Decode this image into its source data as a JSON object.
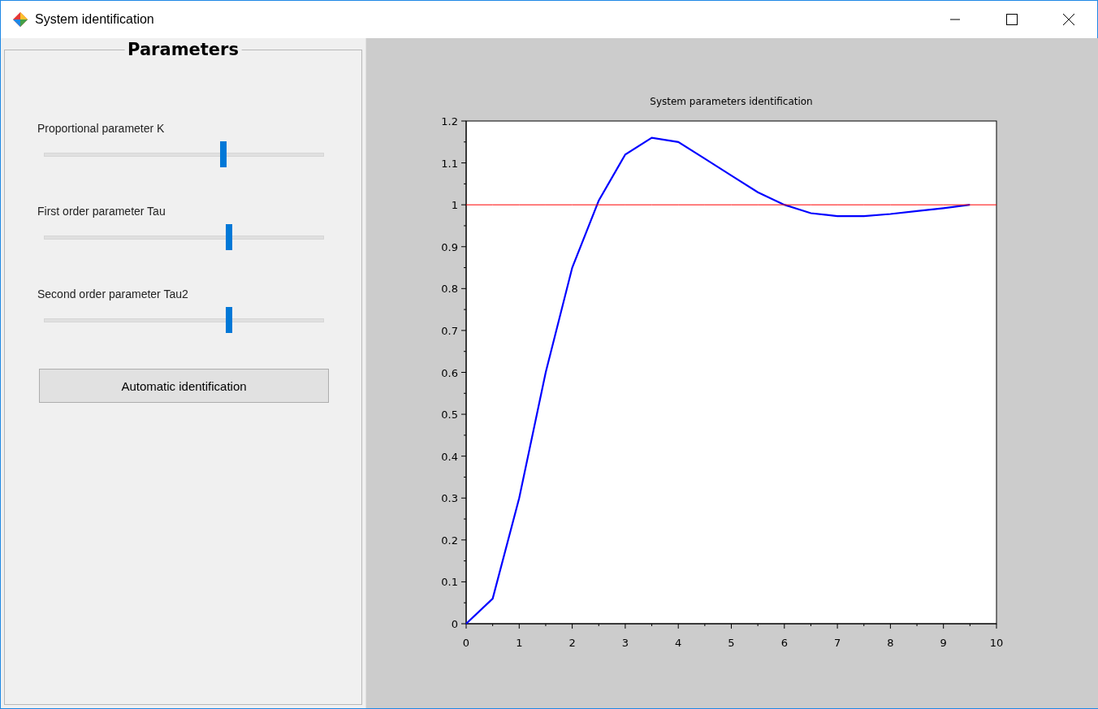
{
  "window": {
    "title": "System identification"
  },
  "parameters": {
    "title": "Parameters",
    "sliders": [
      {
        "label": "Proportional parameter K",
        "level": 0.64
      },
      {
        "label": "First order parameter Tau",
        "level": 0.66
      },
      {
        "label": "Second order parameter Tau2",
        "level": 0.66
      }
    ],
    "button": "Automatic identification"
  },
  "plot": {
    "chart_data": {
      "type": "line",
      "title": "System parameters identification",
      "x": [
        0,
        0.5,
        1,
        1.5,
        2,
        2.5,
        3,
        3.5,
        4,
        4.5,
        5,
        5.5,
        6,
        6.5,
        7,
        7.5,
        8,
        8.5,
        9,
        9.5,
        10
      ],
      "series": [
        {
          "color": "#0000ff",
          "values": [
            0,
            0.06,
            0.3,
            0.6,
            0.85,
            1.01,
            1.12,
            1.16,
            1.15,
            1.11,
            1.07,
            1.03,
            1.0,
            0.98,
            0.973,
            0.973,
            0.978,
            0.985,
            0.992,
            1.0,
            null
          ]
        },
        {
          "color": "#ff0000",
          "values": [
            1,
            1,
            1,
            1,
            1,
            1,
            1,
            1,
            1,
            1,
            1,
            1,
            1,
            1,
            1,
            1,
            1,
            1,
            1,
            1,
            1
          ]
        }
      ],
      "xlim": [
        0,
        10
      ],
      "ylim": [
        0,
        1.2
      ],
      "xticks": [
        0,
        1,
        2,
        3,
        4,
        5,
        6,
        7,
        8,
        9,
        10
      ],
      "yticks": [
        0,
        0.1,
        0.2,
        0.3,
        0.4,
        0.5,
        0.6,
        0.7,
        0.8,
        0.9,
        {
          "value": 1,
          "label": "1"
        },
        1.1,
        1.2
      ]
    }
  }
}
